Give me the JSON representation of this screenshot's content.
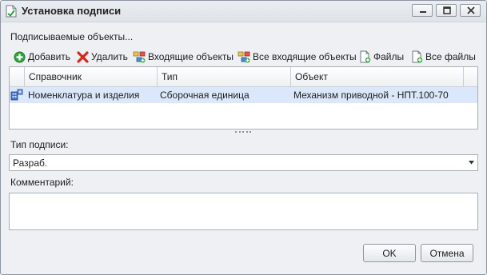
{
  "window": {
    "title": "Установка подписи",
    "icon": "document-sign-icon"
  },
  "objects": {
    "label": "Подписываемые объекты...",
    "toolbar": {
      "add": "Добавить",
      "delete": "Удалить",
      "incoming": "Входящие объекты",
      "all_incoming": "Все входящие объекты",
      "files": "Файлы",
      "all_files": "Все файлы"
    },
    "columns": [
      "Справочник",
      "Тип",
      "Объект"
    ],
    "rows": [
      {
        "directory": "Номенклатура и изделия",
        "type": "Сборочная единица",
        "object": "Механизм приводной - НПТ.100-70",
        "icon": "assembly-icon"
      }
    ]
  },
  "signature": {
    "label": "Тип подписи:",
    "value": "Разраб."
  },
  "comment": {
    "label": "Комментарий:",
    "value": ""
  },
  "buttons": {
    "ok": "OK",
    "cancel": "Отмена"
  },
  "colors": {
    "selected_row": "#dbe8fb",
    "window_bg": "#eef0f3",
    "add_icon": "#2ea43a",
    "delete_icon": "#d8281e"
  }
}
